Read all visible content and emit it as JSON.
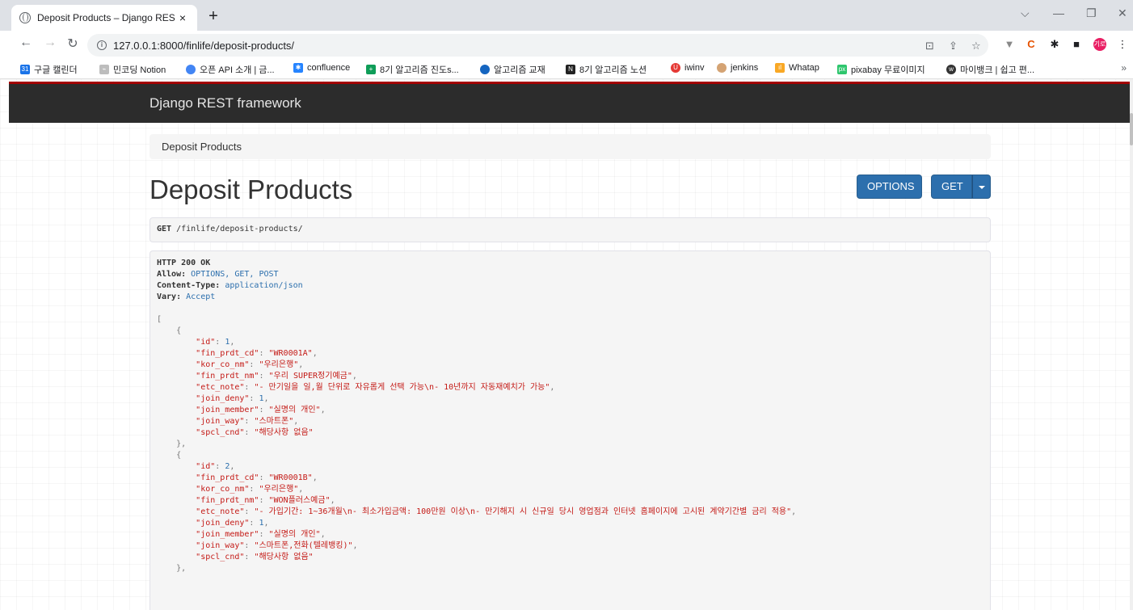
{
  "browser": {
    "tab_title": "Deposit Products – Django RES",
    "url": "127.0.0.1:8000/finlife/deposit-products/",
    "bookmarks": [
      {
        "label": "구글 캘린더",
        "icon": "calendar-icon",
        "color": "#1a73e8"
      },
      {
        "label": "민코딩 Notion",
        "icon": "link-icon",
        "color": "#9e9e9e"
      },
      {
        "label": "오픈 API 소개 | 금...",
        "icon": "globe-icon",
        "color": "#4285f4"
      },
      {
        "label": "confluence",
        "icon": "confluence-icon",
        "color": "#2684ff"
      },
      {
        "label": "8기 알고리즘 진도s...",
        "icon": "sheets-icon",
        "color": "#0f9d58"
      },
      {
        "label": "알고리즘 교재",
        "icon": "cloud-icon",
        "color": "#1565c0"
      },
      {
        "label": "8기 알고리즘 노션",
        "icon": "notion-icon",
        "color": "#222222"
      },
      {
        "label": "iwinv",
        "icon": "iwinv-icon",
        "color": "#e53935"
      },
      {
        "label": "jenkins",
        "icon": "jenkins-icon",
        "color": "#d4a373"
      },
      {
        "label": "Whatap",
        "icon": "whatap-icon",
        "color": "#f9a825"
      },
      {
        "label": "pixabay 무료이미지",
        "icon": "pixabay-icon",
        "color": "#2ec66d"
      },
      {
        "label": "마이뱅크 | 쉽고 편...",
        "icon": "mybank-icon",
        "color": "#333333"
      }
    ],
    "profile_label": "기로"
  },
  "navbar": {
    "brand": "Django REST framework"
  },
  "breadcrumb": "Deposit Products",
  "title": "Deposit Products",
  "buttons": {
    "options": "OPTIONS",
    "get": "GET"
  },
  "request": {
    "method": "GET",
    "path": "/finlife/deposit-products/"
  },
  "response": {
    "status": "HTTP 200 OK",
    "headers": [
      {
        "name": "Allow:",
        "value": "OPTIONS, GET, POST"
      },
      {
        "name": "Content-Type:",
        "value": "application/json"
      },
      {
        "name": "Vary:",
        "value": "Accept"
      }
    ],
    "items": [
      {
        "id": "1",
        "fin_prdt_cd": "\"WR0001A\"",
        "kor_co_nm": "\"우리은행\"",
        "fin_prdt_nm": "\"우리 SUPER정기예금\"",
        "etc_note": "\"- 만기일을 일,월 단위로 자유롭게 선택 가능\\n- 10년까지 자동재예치가 가능\"",
        "join_deny": "1",
        "join_member": "\"실명의 개인\"",
        "join_way": "\"스마트폰\"",
        "spcl_cnd": "\"해당사항 없음\""
      },
      {
        "id": "2",
        "fin_prdt_cd": "\"WR0001B\"",
        "kor_co_nm": "\"우리은행\"",
        "fin_prdt_nm": "\"WON플러스예금\"",
        "etc_note": "\"- 가입기간: 1~36개월\\n- 최소가입금액: 100만원 이상\\n- 만기해지 시 신규일 당시 영업점과 인터넷 홈페이지에 고시된 계약기간별 금리 적용\"",
        "join_deny": "1",
        "join_member": "\"실명의 개인\"",
        "join_way": "\"스마트폰,전화(텔레뱅킹)\"",
        "spcl_cnd": "\"해당사항 없음\""
      }
    ]
  }
}
